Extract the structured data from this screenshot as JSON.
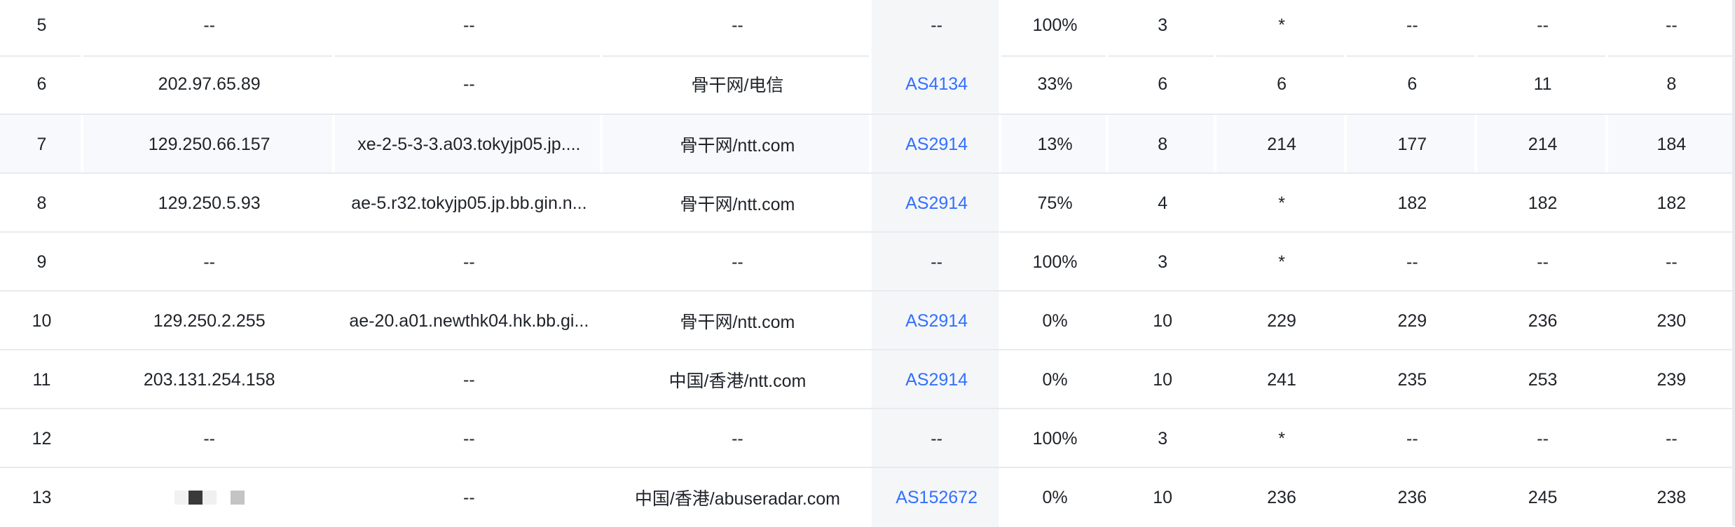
{
  "rows": [
    {
      "hop": "5",
      "ip": "--",
      "host": "--",
      "location": "--",
      "asn": "--",
      "asn_link": false,
      "loss": "100%",
      "sent": "3",
      "last": "*",
      "best": "--",
      "worst": "--",
      "avg": "--"
    },
    {
      "hop": "6",
      "ip": "202.97.65.89",
      "host": "--",
      "location": "骨干网/电信",
      "asn": "AS4134",
      "asn_link": true,
      "loss": "33%",
      "sent": "6",
      "last": "6",
      "best": "6",
      "worst": "11",
      "avg": "8"
    },
    {
      "hop": "7",
      "ip": "129.250.66.157",
      "host": "xe-2-5-3-3.a03.tokyjp05.jp....",
      "location": "骨干网/ntt.com",
      "asn": "AS2914",
      "asn_link": true,
      "loss": "13%",
      "sent": "8",
      "last": "214",
      "best": "177",
      "worst": "214",
      "avg": "184"
    },
    {
      "hop": "8",
      "ip": "129.250.5.93",
      "host": "ae-5.r32.tokyjp05.jp.bb.gin.n...",
      "location": "骨干网/ntt.com",
      "asn": "AS2914",
      "asn_link": true,
      "loss": "75%",
      "sent": "4",
      "last": "*",
      "best": "182",
      "worst": "182",
      "avg": "182"
    },
    {
      "hop": "9",
      "ip": "--",
      "host": "--",
      "location": "--",
      "asn": "--",
      "asn_link": false,
      "loss": "100%",
      "sent": "3",
      "last": "*",
      "best": "--",
      "worst": "--",
      "avg": "--"
    },
    {
      "hop": "10",
      "ip": "129.250.2.255",
      "host": "ae-20.a01.newthk04.hk.bb.gi...",
      "location": "骨干网/ntt.com",
      "asn": "AS2914",
      "asn_link": true,
      "loss": "0%",
      "sent": "10",
      "last": "229",
      "best": "229",
      "worst": "236",
      "avg": "230"
    },
    {
      "hop": "11",
      "ip": "203.131.254.158",
      "host": "--",
      "location": "中国/香港/ntt.com",
      "asn": "AS2914",
      "asn_link": true,
      "loss": "0%",
      "sent": "10",
      "last": "241",
      "best": "235",
      "worst": "253",
      "avg": "239"
    },
    {
      "hop": "12",
      "ip": "--",
      "host": "--",
      "location": "--",
      "asn": "--",
      "asn_link": false,
      "loss": "100%",
      "sent": "3",
      "last": "*",
      "best": "--",
      "worst": "--",
      "avg": "--"
    },
    {
      "hop": "13",
      "ip": "",
      "host": "--",
      "location": "中国/香港/abuseradar.com",
      "asn": "AS152672",
      "asn_link": true,
      "loss": "0%",
      "sent": "10",
      "last": "236",
      "best": "236",
      "worst": "245",
      "avg": "238"
    }
  ],
  "colors": {
    "link": "#3370ff",
    "highlight_row": "#f7f9fc",
    "asn_bg": "#f4f6f8",
    "grid": "#e8eaee"
  }
}
